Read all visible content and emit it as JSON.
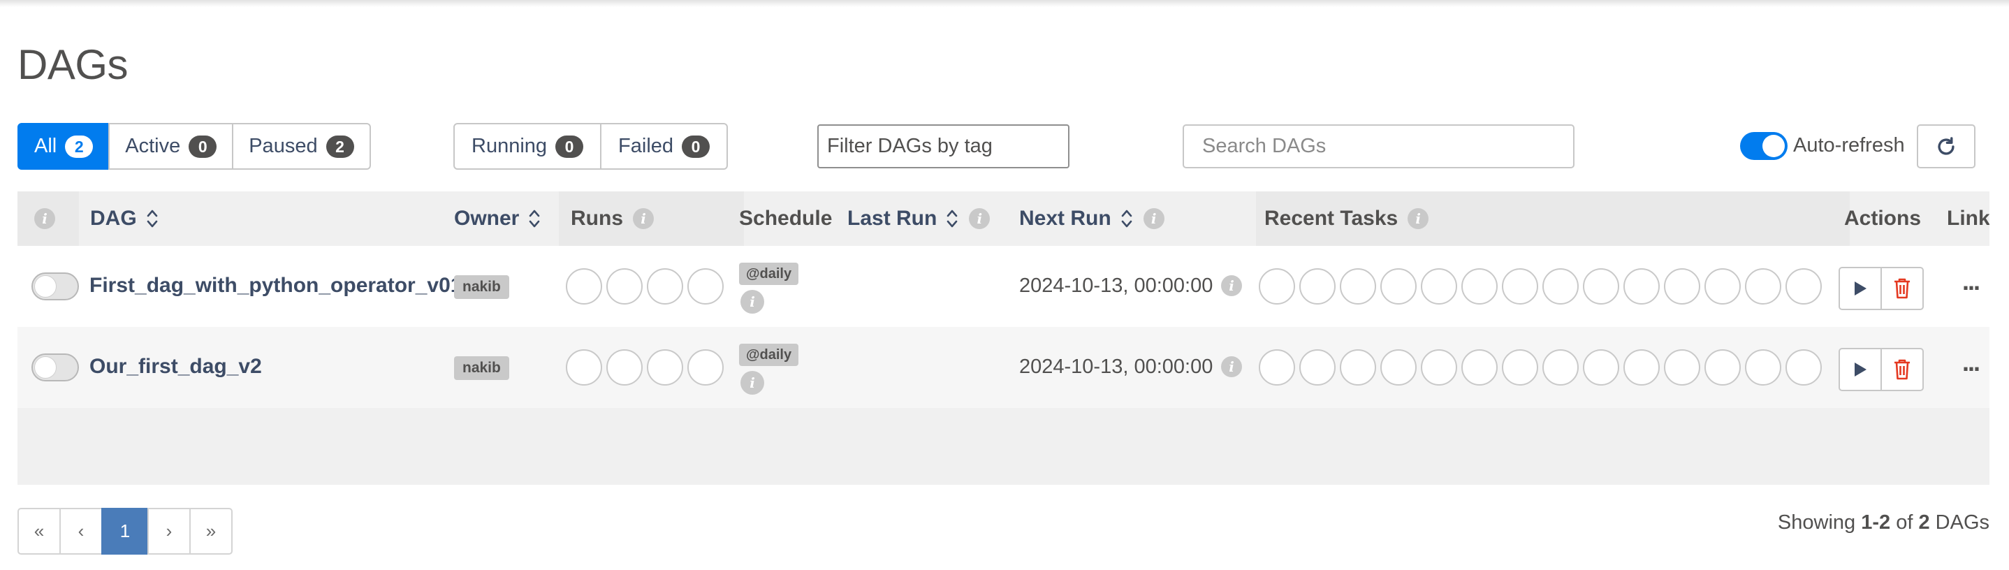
{
  "page": {
    "title": "DAGs"
  },
  "status_filters": [
    {
      "label": "All",
      "count": "2",
      "active": true
    },
    {
      "label": "Active",
      "count": "0",
      "active": false
    },
    {
      "label": "Paused",
      "count": "2",
      "active": false
    }
  ],
  "run_filters": [
    {
      "label": "Running",
      "count": "0"
    },
    {
      "label": "Failed",
      "count": "0"
    }
  ],
  "tag_filter": {
    "placeholder": "Filter DAGs by tag"
  },
  "search": {
    "placeholder": "Search DAGs"
  },
  "auto_refresh": {
    "label": "Auto-refresh",
    "enabled": true
  },
  "table": {
    "columns": {
      "dag": "DAG",
      "owner": "Owner",
      "runs": "Runs",
      "schedule": "Schedule",
      "last_run": "Last Run",
      "next_run": "Next Run",
      "recent_tasks": "Recent Tasks",
      "actions": "Actions",
      "links": "Links"
    },
    "rows": [
      {
        "dag_id": "First_dag_with_python_operator_v01",
        "owner": "nakib",
        "schedule": "@daily",
        "last_run": "",
        "next_run": "2024-10-13, 00:00:00",
        "paused": true
      },
      {
        "dag_id": "Our_first_dag_v2",
        "owner": "nakib",
        "schedule": "@daily",
        "last_run": "",
        "next_run": "2024-10-13, 00:00:00",
        "paused": true
      }
    ],
    "more_menu": "..."
  },
  "pagination": {
    "first": "«",
    "prev": "‹",
    "current": "1",
    "next": "›",
    "last": "»"
  },
  "showing": {
    "prefix": "Showing",
    "range": "1-2",
    "of": "of",
    "total": "2",
    "suffix": "DAGs"
  },
  "colors": {
    "accent": "#017cee",
    "link": "#3d4c66",
    "delete": "#e43921",
    "pagination_active": "#4a7cb9"
  },
  "icons": [
    "info-icon",
    "sort-icon",
    "refresh-icon",
    "play-icon",
    "trash-icon",
    "ellipsis-icon"
  ]
}
